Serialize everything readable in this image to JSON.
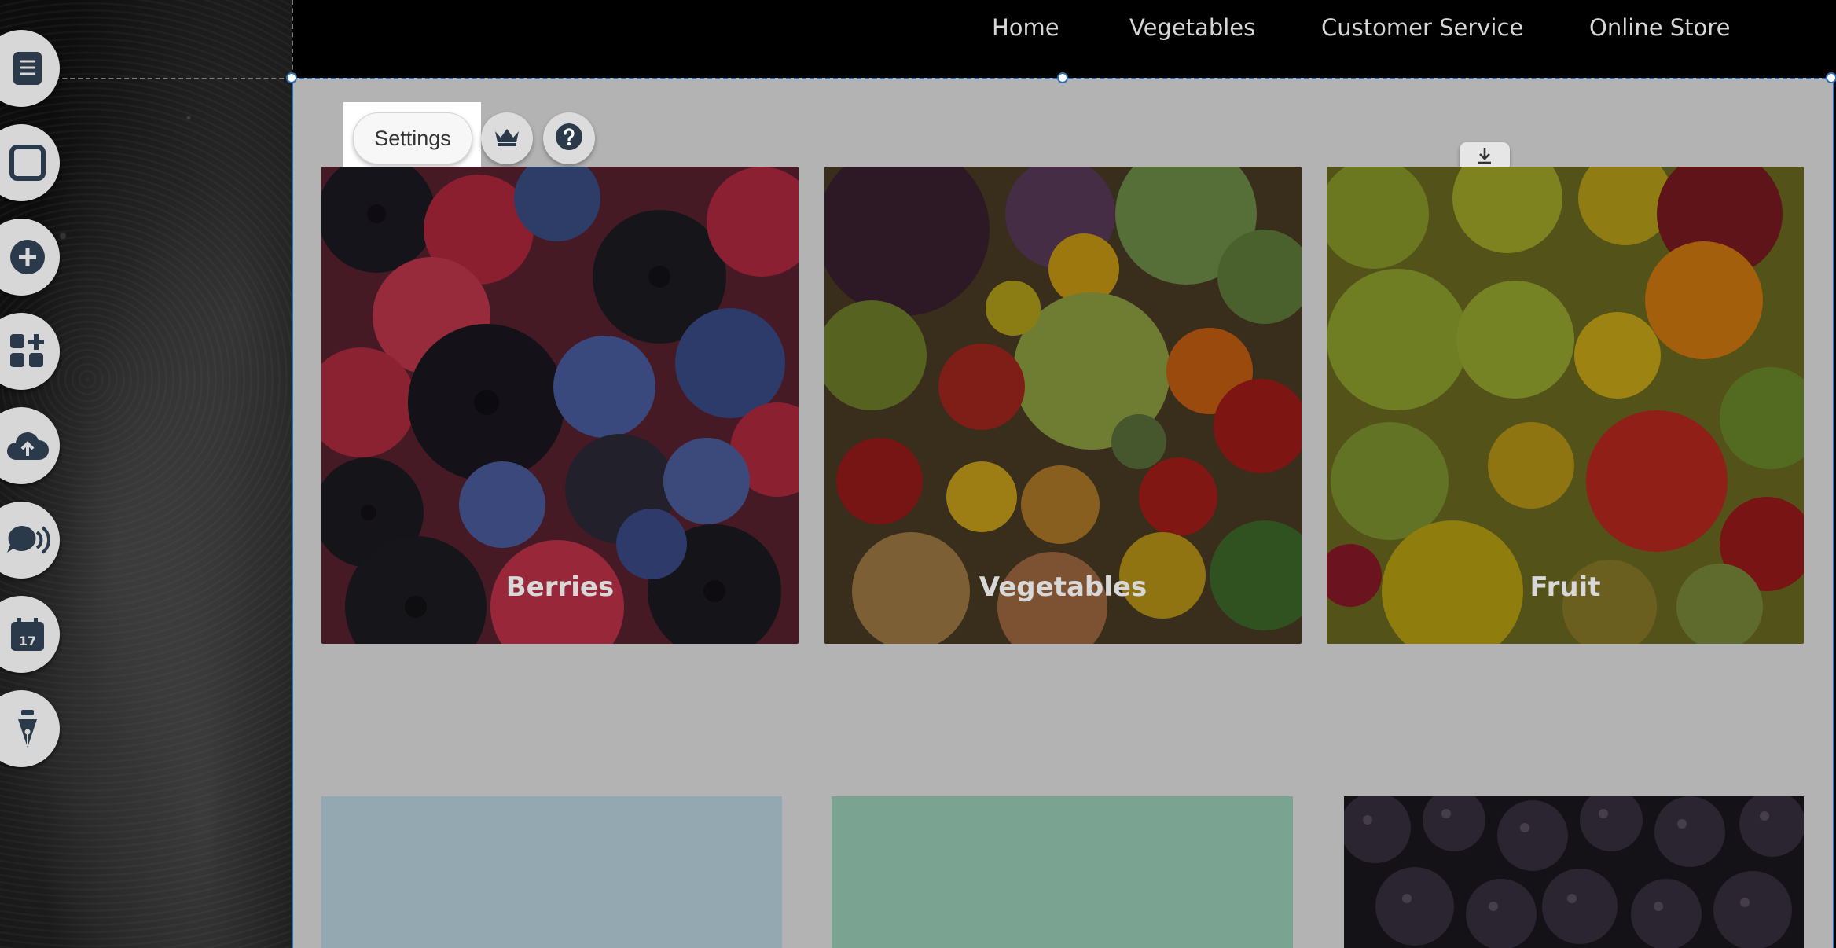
{
  "nav": {
    "items": [
      {
        "label": "Home"
      },
      {
        "label": "Vegetables"
      },
      {
        "label": "Customer Service"
      },
      {
        "label": "Online Store"
      }
    ]
  },
  "toolbar": {
    "settings_label": "Settings",
    "crown_icon": "crown-icon",
    "help_icon": "help-icon"
  },
  "tiles": [
    {
      "label": "Berries"
    },
    {
      "label": "Vegetables"
    },
    {
      "label": "Fruit"
    }
  ],
  "rail": {
    "icons": [
      "pages-icon",
      "background-icon",
      "add-icon",
      "apps-icon",
      "upload-icon",
      "social-icon",
      "events-icon",
      "blog-pen-icon"
    ]
  },
  "colors": {
    "nav_bg": "#000000",
    "nav_text": "#d6d6d6",
    "stage_bg": "#b3b3b3",
    "selection": "#2f6fb0",
    "block_blue": "#93a8b1",
    "block_green": "#7aa392"
  }
}
